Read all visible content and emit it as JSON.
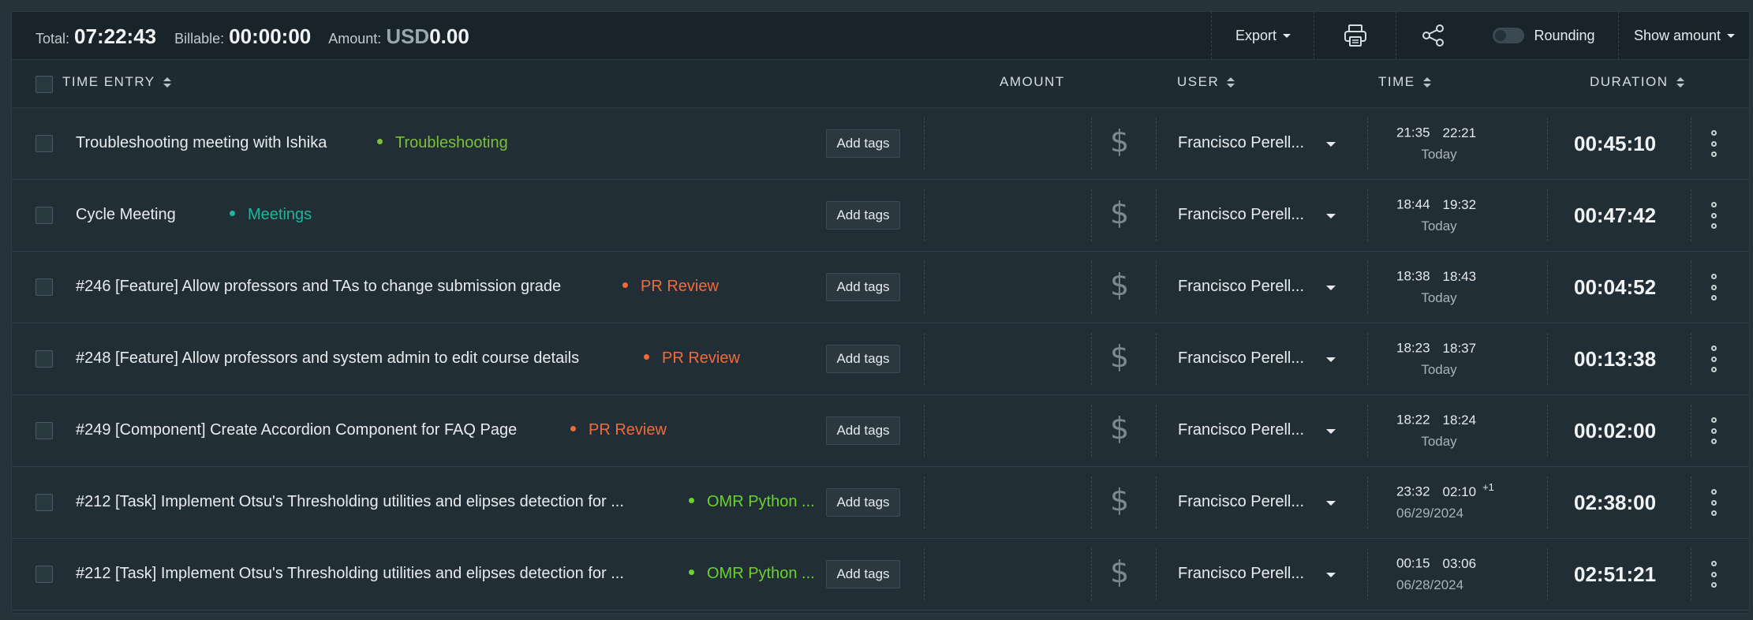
{
  "summary": {
    "total_label": "Total:",
    "total_value": "07:22:43",
    "billable_label": "Billable:",
    "billable_value": "00:00:00",
    "amount_label": "Amount:",
    "amount_currency": "USD",
    "amount_value": "0.00"
  },
  "toolbar": {
    "export_label": "Export",
    "rounding_label": "Rounding",
    "rounding_enabled": false,
    "show_amount_label": "Show amount"
  },
  "columns": {
    "time_entry": "TIME ENTRY",
    "amount": "AMOUNT",
    "user": "USER",
    "time": "TIME",
    "duration": "DURATION"
  },
  "add_tags_label": "Add tags",
  "entries": [
    {
      "description": "Troubleshooting meeting with Ishika",
      "project": "Troubleshooting",
      "project_color": "#7cbf3a",
      "user": "Francisco Perell...",
      "start": "21:35",
      "end": "22:21",
      "extra": "",
      "date": "Today",
      "duration": "00:45:10"
    },
    {
      "description": "Cycle Meeting",
      "project": "Meetings",
      "project_color": "#1fb59a",
      "user": "Francisco Perell...",
      "start": "18:44",
      "end": "19:32",
      "extra": "",
      "date": "Today",
      "duration": "00:47:42"
    },
    {
      "description": "#246 [Feature] Allow professors and TAs to change submission grade",
      "project": "PR Review",
      "project_color": "#f26a3b",
      "user": "Francisco Perell...",
      "start": "18:38",
      "end": "18:43",
      "extra": "",
      "date": "Today",
      "duration": "00:04:52"
    },
    {
      "description": "#248 [Feature] Allow professors and system admin to edit course details",
      "project": "PR Review",
      "project_color": "#f26a3b",
      "user": "Francisco Perell...",
      "start": "18:23",
      "end": "18:37",
      "extra": "",
      "date": "Today",
      "duration": "00:13:38"
    },
    {
      "description": "#249 [Component] Create Accordion Component for FAQ Page",
      "project": "PR Review",
      "project_color": "#f26a3b",
      "user": "Francisco Perell...",
      "start": "18:22",
      "end": "18:24",
      "extra": "",
      "date": "Today",
      "duration": "00:02:00"
    },
    {
      "description": "#212 [Task] Implement Otsu's Thresholding utilities and elipses detection for ...",
      "project": "OMR Python ...",
      "project_color": "#6ad32a",
      "user": "Francisco Perell...",
      "start": "23:32",
      "end": "02:10",
      "extra": "+1",
      "date": "06/29/2024",
      "duration": "02:38:00"
    },
    {
      "description": "#212 [Task] Implement Otsu's Thresholding utilities and elipses detection for ...",
      "project": "OMR Python ...",
      "project_color": "#6ad32a",
      "user": "Francisco Perell...",
      "start": "00:15",
      "end": "03:06",
      "extra": "",
      "date": "06/28/2024",
      "duration": "02:51:21"
    }
  ]
}
